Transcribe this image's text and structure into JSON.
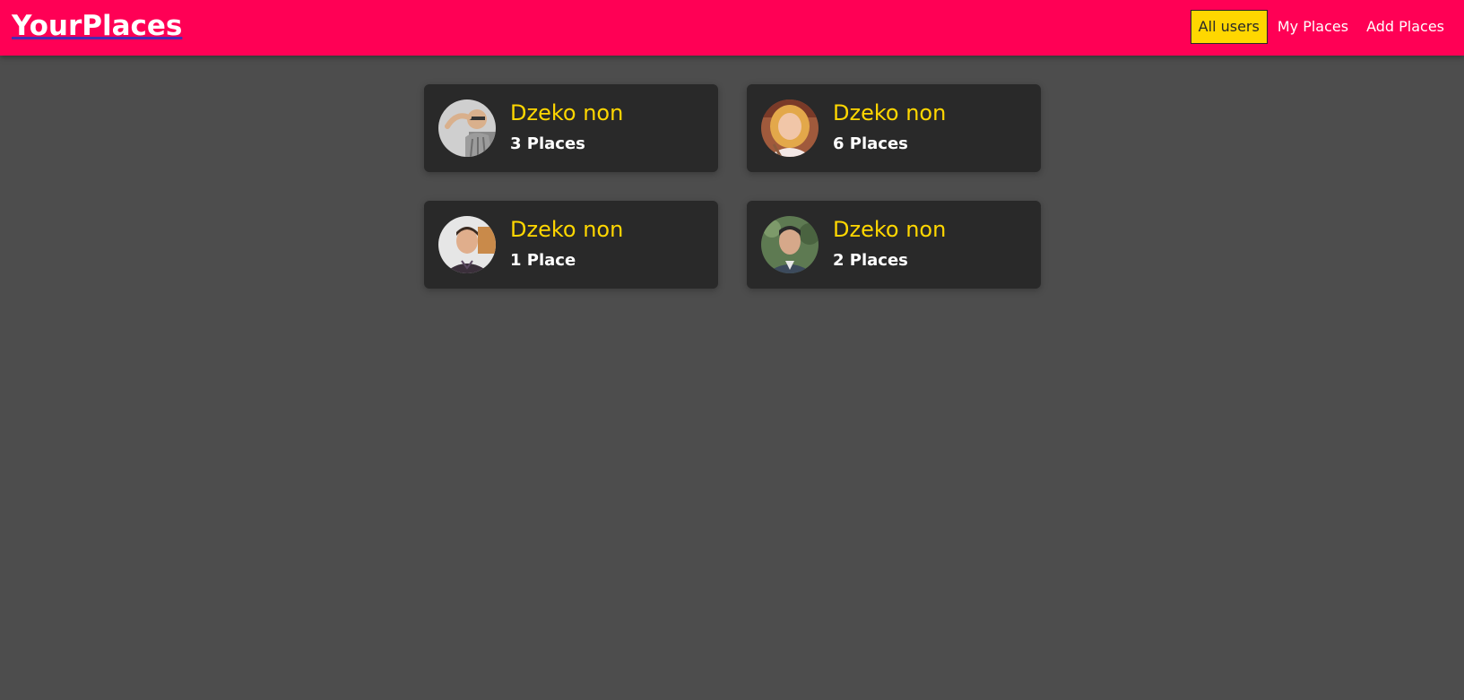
{
  "header": {
    "logo": "YourPlaces",
    "nav": {
      "all_users": "All users",
      "my_places": "My Places",
      "add_places": "Add Places"
    },
    "colors": {
      "header_bg": "#ff0055",
      "active_bg": "#ffd700"
    }
  },
  "users": [
    {
      "name": "Dzeko non",
      "places": "3 Places"
    },
    {
      "name": "Dzeko non",
      "places": "6 Places"
    },
    {
      "name": "Dzeko non",
      "places": "1 Place"
    },
    {
      "name": "Dzeko non",
      "places": "2 Places"
    }
  ],
  "colors": {
    "page_bg": "#4d4d4d",
    "card_bg": "#292929",
    "name_color": "#ffd700"
  }
}
